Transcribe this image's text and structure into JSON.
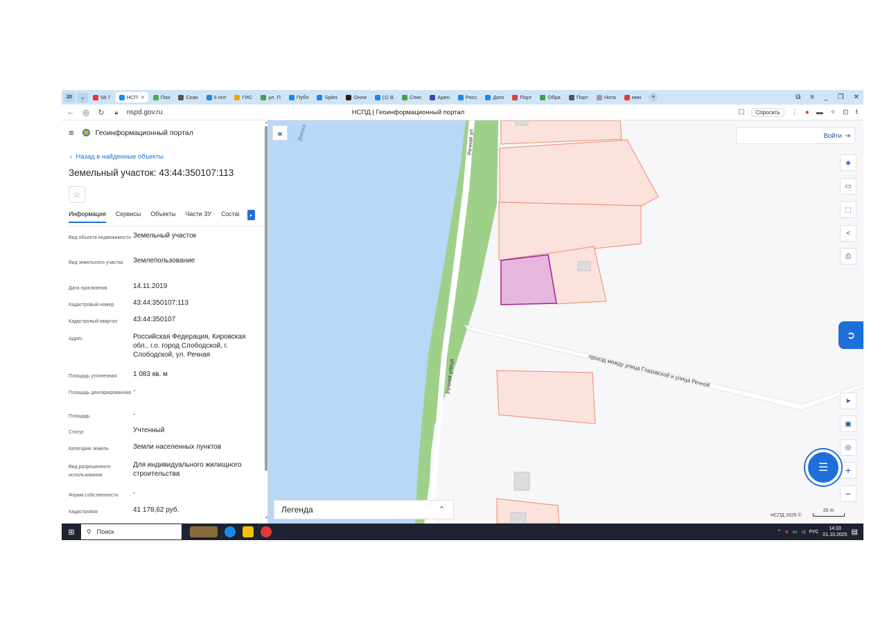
{
  "browser": {
    "tab_counter": "20",
    "tabs": [
      {
        "label": "58.7",
        "color": "#e53935",
        "active": false
      },
      {
        "label": "НСП",
        "color": "#1e88e5",
        "active": true
      },
      {
        "label": "Пои",
        "color": "#4caf50",
        "active": false
      },
      {
        "label": "Скан",
        "color": "#555555",
        "active": false
      },
      {
        "label": "6 пот",
        "color": "#1e88e5",
        "active": false
      },
      {
        "label": "ГИС",
        "color": "#f4a300",
        "active": false
      },
      {
        "label": "ул. П",
        "color": "#43a047",
        "active": false
      },
      {
        "label": "Публ",
        "color": "#1e88e5",
        "active": false
      },
      {
        "label": "Splex",
        "color": "#1e88e5",
        "active": false
      },
      {
        "label": "Онли",
        "color": "#222222",
        "active": false
      },
      {
        "label": "(1) В",
        "color": "#1e88e5",
        "active": false
      },
      {
        "label": "Спис",
        "color": "#43a047",
        "active": false
      },
      {
        "label": "Арен",
        "color": "#3949ab",
        "active": false
      },
      {
        "label": "Росс",
        "color": "#1e88e5",
        "active": false
      },
      {
        "label": "Дого",
        "color": "#1e88e5",
        "active": false
      },
      {
        "label": "Порт",
        "color": "#e53935",
        "active": false
      },
      {
        "label": "Обра",
        "color": "#43a047",
        "active": false
      },
      {
        "label": "Порт",
        "color": "#555555",
        "active": false
      },
      {
        "label": "Нота",
        "color": "#9e9e9e",
        "active": false
      },
      {
        "label": "мин",
        "color": "#e53935",
        "active": false
      }
    ],
    "url": "nspd.gov.ru",
    "page_title": "НСПД | Геоинформационный портал",
    "ask_label": "Спросить"
  },
  "sidebar": {
    "brand": "Геоинформационный портал",
    "back_link": "Назад в найденные объекты",
    "title": "Земельный участок: 43:44:350107:113",
    "tabs": [
      "Информация",
      "Сервисы",
      "Объекты",
      "Части ЗУ",
      "Состав"
    ],
    "properties": [
      {
        "label": "Вид объекта недвижимости",
        "value": "Земельный участок"
      },
      {
        "label": "Вид земельного участка",
        "value": "Землепользование"
      },
      {
        "label": "Дата присвоения",
        "value": "14.11.2019"
      },
      {
        "label": "Кадастровый номер",
        "value": "43:44:350107:113"
      },
      {
        "label": "Кадастровый квартал",
        "value": "43:44:350107"
      },
      {
        "label": "Адрес",
        "value": "Российская Федерация, Кировская обл., г.о. город Слободской, г. Слободской, ул. Речная"
      },
      {
        "label": "Площадь уточненная",
        "value": "1 083 кв. м"
      },
      {
        "label": "Площадь декларированная",
        "value": "-"
      },
      {
        "label": "Площадь",
        "value": "-"
      },
      {
        "label": "Статус",
        "value": "Учтенный"
      },
      {
        "label": "Категория земель",
        "value": "Земли населенных пунктов"
      },
      {
        "label": "Вид разрешенного использования",
        "value": "Для индивидуального жилищного строительства"
      },
      {
        "label": "Форма собственности",
        "value": "-"
      },
      {
        "label": "Кадастровая",
        "value": "41 178,62 руб."
      }
    ]
  },
  "map": {
    "water_label": "Вятка",
    "street_labels": [
      "Речная ул",
      "Речная улица",
      "проезд между улица Глазовской и улица Речной"
    ],
    "login_label": "Войти",
    "legend_label": "Легенда",
    "attribution": "НСПД 2025 ©",
    "scale_label": "20 m",
    "colors": {
      "water": "#b9d7f7",
      "park": "#9fd08a",
      "parcel_stroke": "#f08a6c",
      "parcel_fill": "#fbe2dc",
      "selected_stroke": "#a0208f",
      "selected_fill": "#e7b6de",
      "accent": "#1e6fd9"
    }
  },
  "taskbar": {
    "search_label": "Поиск",
    "lang": "РУС",
    "time": "14:33",
    "date": "01.10.2025"
  }
}
